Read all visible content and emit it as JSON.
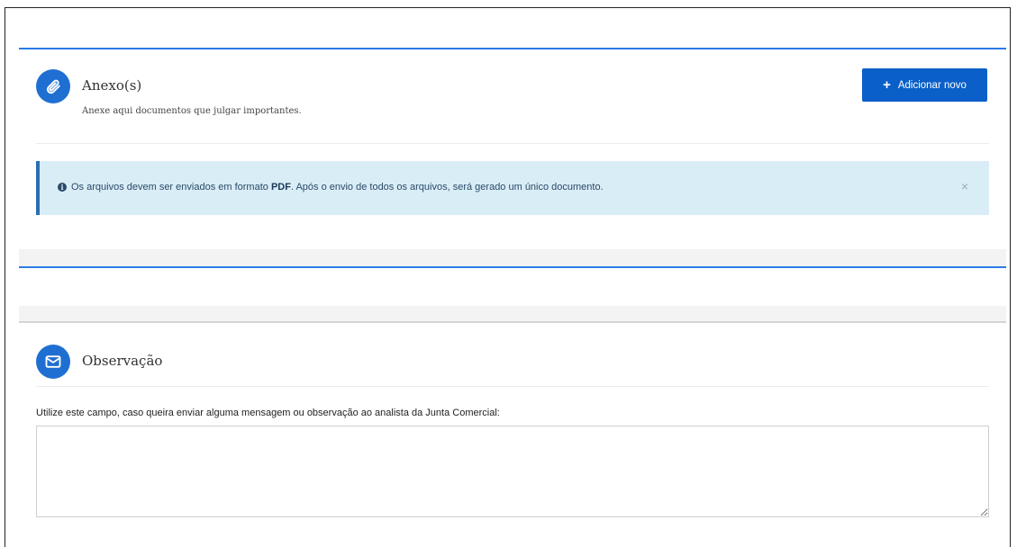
{
  "anexo": {
    "title": "Anexo(s)",
    "subtitle": "Anexe aqui documentos que julgar importantes.",
    "icon": "paperclip-icon",
    "add_button": {
      "icon": "plus-icon",
      "label": "Adicionar novo"
    },
    "alert": {
      "icon": "info-icon",
      "text_before": "Os arquivos devem ser enviados em formato ",
      "text_bold": "PDF",
      "text_after": ". Após o envio de todos os arquivos, será gerado um único documento.",
      "close": "×"
    }
  },
  "observacao": {
    "title": "Observação",
    "icon": "envelope-icon",
    "label": "Utilize este campo, caso queira enviar alguma mensagem ou observação ao analista da Junta Comercial:",
    "textarea_value": ""
  },
  "colors": {
    "accent": "#1f6fd2",
    "button": "#0a5fc8",
    "alert_bg": "#d9edf7",
    "alert_border": "#2a6fb0",
    "section_border": "#2c7be5"
  }
}
